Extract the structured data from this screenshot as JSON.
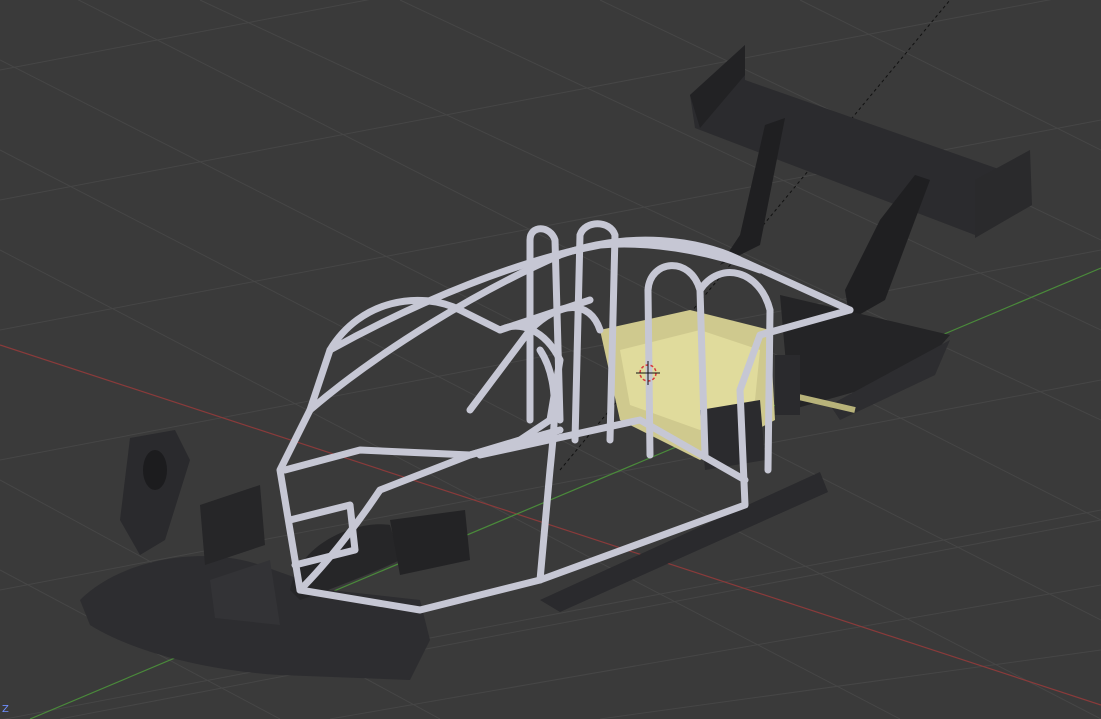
{
  "viewport": {
    "background": "#3a3a3a",
    "grid_color": "#444444",
    "x_axis_color": "#8a3a3a",
    "y_axis_color": "#4a8a3a",
    "axis_indicator": "Z"
  },
  "scene": {
    "objects": [
      {
        "name": "roll-cage",
        "color": "#c9cad6"
      },
      {
        "name": "engine",
        "color": "#d6d19a"
      },
      {
        "name": "rear-wing",
        "color": "#2b2b2e"
      },
      {
        "name": "front-bodywork",
        "color": "#2d2d30"
      },
      {
        "name": "side-skirt",
        "color": "#2a2a2d"
      },
      {
        "name": "3d-cursor",
        "color": "#d83c3c"
      }
    ]
  }
}
